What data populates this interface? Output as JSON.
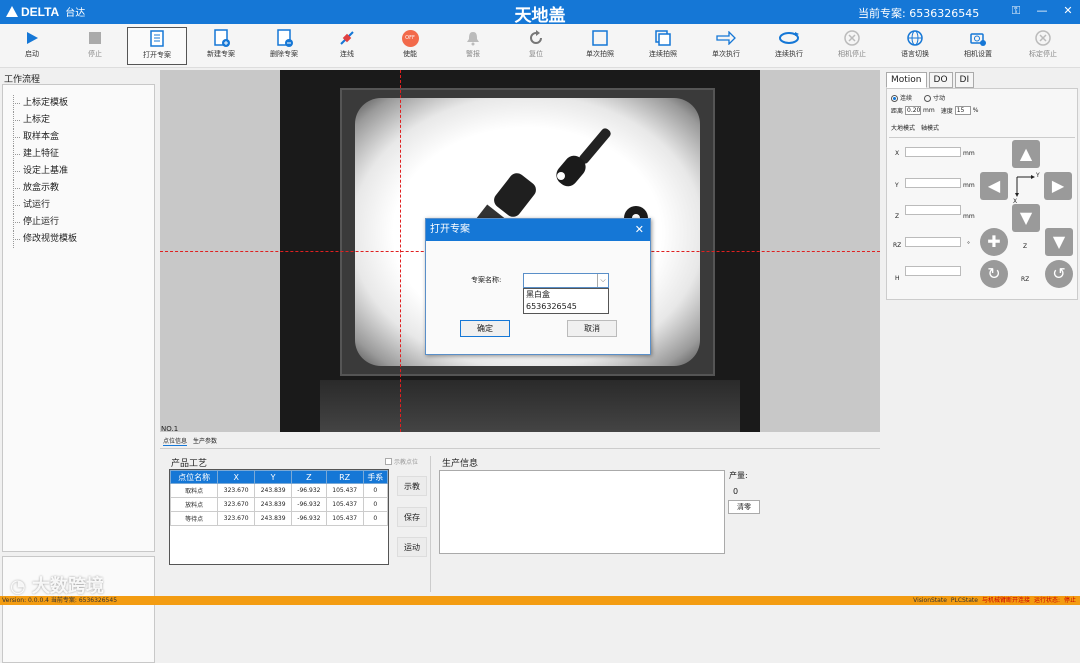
{
  "title_bar": {
    "logo_text": "DELTA",
    "logo_sub": "台达",
    "app_title": "天地盖",
    "current_project_label": "当前专案:",
    "current_project_value": "6536326545"
  },
  "toolbar": {
    "start": "启动",
    "stop": "停止",
    "open_project": "打开专案",
    "new_project": "新建专案",
    "delete_project": "删除专案",
    "connect": "连线",
    "enable": "使能",
    "enable_badge": "OFF",
    "alarm": "警报",
    "reset": "复位",
    "single_capture": "单次拍照",
    "continuous_capture": "连续拍照",
    "single_run": "单次执行",
    "continuous_run": "连续执行",
    "camera_stop": "相机停止",
    "language_switch": "语言切换",
    "camera_settings": "相机设置",
    "calibration_stop": "标定停止"
  },
  "workflow": {
    "title": "工作流程",
    "items": [
      "上标定模板",
      "上标定",
      "取样本盒",
      "建上特征",
      "设定上基准",
      "放盒示教",
      "试运行",
      "停止运行",
      "修改视觉模板"
    ]
  },
  "viewer": {
    "label": "NO.1"
  },
  "motion_panel": {
    "tabs": [
      "Motion",
      "DO",
      "DI"
    ],
    "mode_continuous": "连续",
    "mode_inch": "寸动",
    "distance_label": "距离",
    "distance_value": "0.20",
    "distance_unit": "mm",
    "speed_label": "速度",
    "speed_value": "15",
    "speed_unit": "%",
    "subtab_world": "大地模式",
    "subtab_axis": "轴模式",
    "axes": [
      {
        "label": "X",
        "unit": "mm"
      },
      {
        "label": "Y",
        "unit": "mm"
      },
      {
        "label": "Z",
        "unit": "mm"
      },
      {
        "label": "RZ",
        "unit": "°"
      },
      {
        "label": "H",
        "unit": ""
      }
    ],
    "jog_z_label": "Z",
    "jog_rz_label": "RZ",
    "coord_y": "Y",
    "coord_x": "X"
  },
  "bottom": {
    "tab_points": "点位信息",
    "tab_params": "生产参数",
    "product_group": "产品工艺",
    "teach_checkbox": "示教点位",
    "table_headers": [
      "点位名称",
      "X",
      "Y",
      "Z",
      "RZ",
      "手系"
    ],
    "table_rows": [
      [
        "取料点",
        "323.670",
        "243.839",
        "-96.932",
        "105.437",
        "0"
      ],
      [
        "放料点",
        "323.670",
        "243.839",
        "-96.932",
        "105.437",
        "0"
      ],
      [
        "等待点",
        "323.670",
        "243.839",
        "-96.932",
        "105.437",
        "0"
      ]
    ],
    "btn_teach": "示教",
    "btn_save": "保存",
    "btn_move": "运动",
    "production_group": "生产信息",
    "yield_label": "产量:",
    "yield_value": "0",
    "btn_clear": "清零"
  },
  "dialog": {
    "title": "打开专案",
    "field_label": "专案名称:",
    "combo_value": "",
    "options": [
      "黑白盒",
      "6536326545"
    ],
    "ok": "确定",
    "cancel": "取消"
  },
  "status_bar": {
    "version": "Version: 0.0.0.4",
    "project": "当前专案: 6536326545",
    "vision_state": "VisionState",
    "plc_state": "PLCState",
    "robot_msg": "与机械臂断开连接",
    "run_state_label": "运行状态:",
    "run_state_value": "停止"
  },
  "watermark": "大数跨境",
  "colors": {
    "primary": "#1577d6",
    "status_bar": "#f39c12",
    "crosshair": "#e02020"
  }
}
